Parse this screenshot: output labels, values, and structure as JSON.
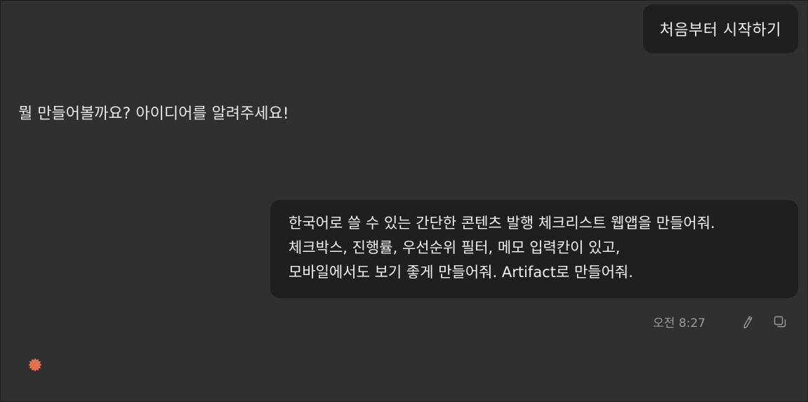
{
  "conversation": {
    "first_user_message": "처음부터 시작하기",
    "assistant_message": "뭘 만들어볼까요? 아이디어를 알려주세요!",
    "second_user_message_lines": [
      "한국어로 쓸 수 있는 간단한 콘텐츠 발행 체크리스트 웹앱을 만들어줘.",
      "체크박스, 진행률, 우선순위 필터, 메모 입력칸이 있고,",
      "모바일에서도 보기 좋게 만들어줘. Artifact로 만들어줘."
    ],
    "timestamp": "오전 8:27"
  },
  "icons": {
    "edit": "pencil-icon",
    "copy": "copy-icon",
    "status": "sparkle-icon"
  },
  "colors": {
    "background": "#303030",
    "bubble": "#1f1f1f",
    "accent": "#e0714f"
  }
}
